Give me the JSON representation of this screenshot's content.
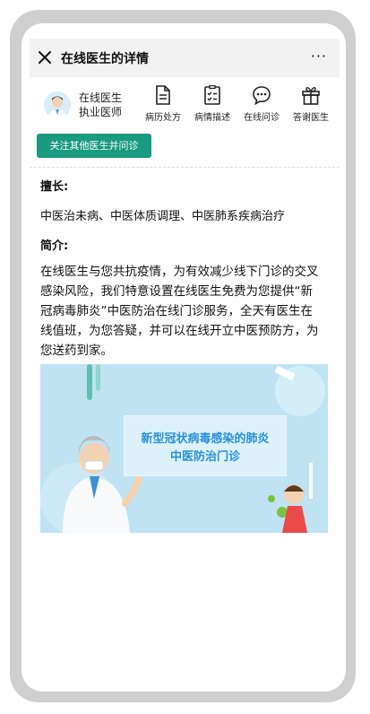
{
  "header": {
    "title": "在线医生的详情",
    "more": "···"
  },
  "doctor": {
    "name": "在线医生",
    "title": "执业医师"
  },
  "actions": [
    {
      "label": "病历处方",
      "icon": "document-icon"
    },
    {
      "label": "病情描述",
      "icon": "checklist-icon"
    },
    {
      "label": "在线问诊",
      "icon": "chat-icon"
    },
    {
      "label": "答谢医生",
      "icon": "gift-icon"
    }
  ],
  "follow_button": "关注其他医生并问诊",
  "specialty": {
    "label": "擅长:",
    "text": "中医治未病、中医体质调理、中医肺系疾病治疗"
  },
  "intro": {
    "label": "简介:",
    "text": "在线医生与您共抗疫情，为有效减少线下门诊的交叉感染风险，我们特意设置在线医生免费为您提供“新冠病毒肺炎”中医防治在线门诊服务，全天有医生在线值班，为您答疑，并可以在线开立中医预防方，为您送药到家。"
  },
  "banner": {
    "line1": "新型冠状病毒感染的肺炎",
    "line2": "中医防治门诊"
  }
}
